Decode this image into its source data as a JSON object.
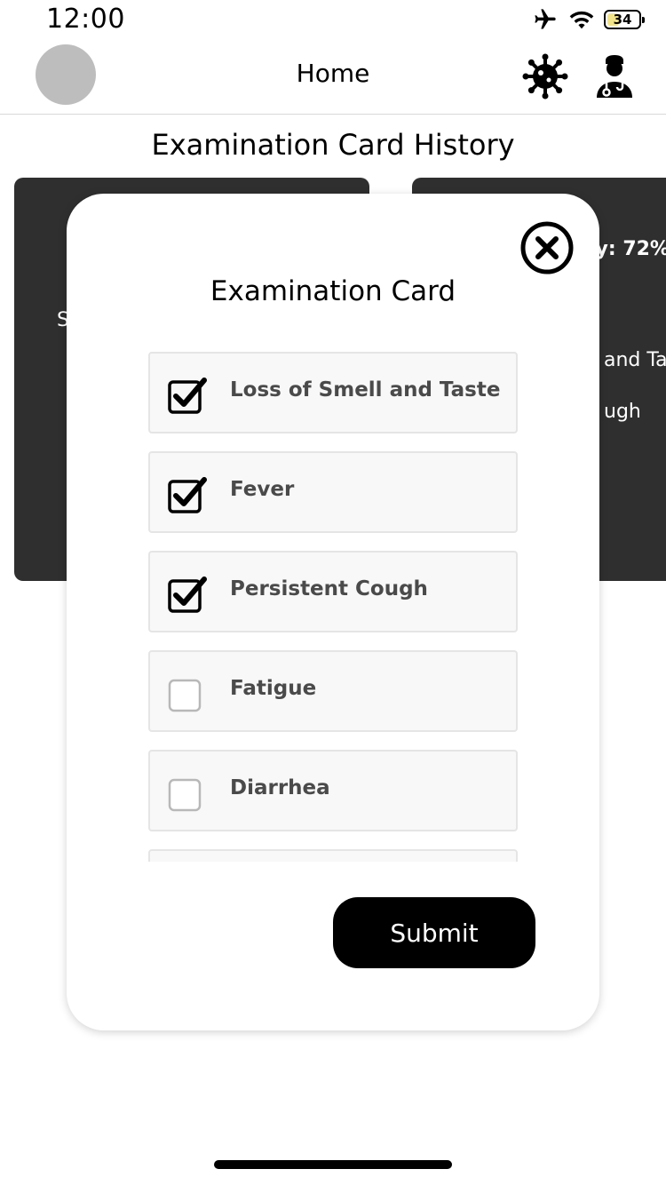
{
  "status_bar": {
    "time": "12:00",
    "battery_level": "34",
    "icons": [
      "airplane-icon",
      "wifi-icon",
      "battery-icon"
    ]
  },
  "nav": {
    "title": "Home",
    "icons": [
      "virus-icon",
      "doctor-icon"
    ]
  },
  "page": {
    "section_title": "Examination Card History"
  },
  "background_cards": {
    "left": {
      "visible_fragment": "S"
    },
    "right": {
      "line1": "ty: 72%",
      "line2": "and Ta",
      "line3": "ugh"
    }
  },
  "modal": {
    "title": "Examination Card",
    "close_icon": "close-icon",
    "symptoms": [
      {
        "label": "Loss of Smell and Taste",
        "checked": true
      },
      {
        "label": "Fever",
        "checked": true
      },
      {
        "label": "Persistent Cough",
        "checked": true
      },
      {
        "label": "Fatigue",
        "checked": false
      },
      {
        "label": "Diarrhea",
        "checked": false
      }
    ],
    "submit_label": "Submit"
  },
  "colors": {
    "card_dark": "#2f2f2f",
    "button": "#000000",
    "item_bg": "#f8f8f8",
    "item_border": "#e5e5e5",
    "label_text": "#4a4a4a"
  }
}
